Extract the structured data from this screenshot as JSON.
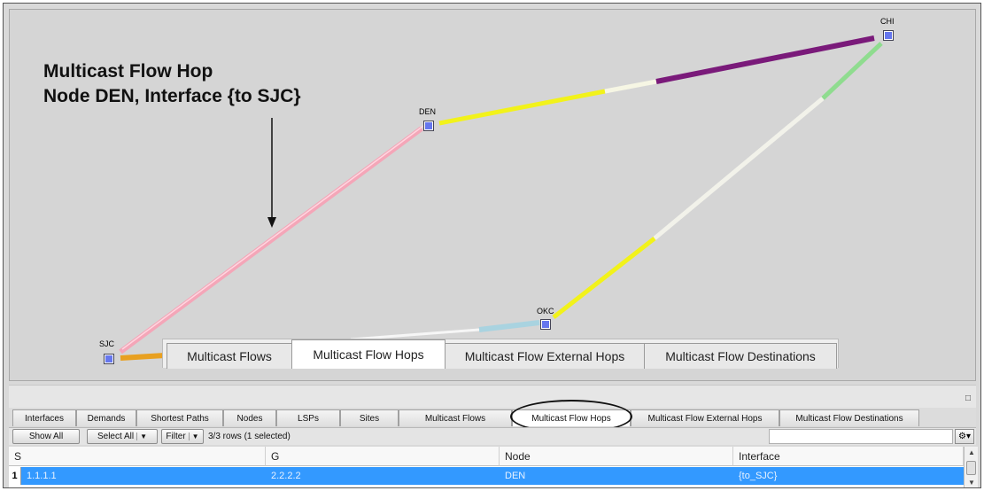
{
  "annotation": {
    "line1": "Multicast Flow Hop",
    "line2": "Node DEN, Interface {to SJC}"
  },
  "map": {
    "nodes": [
      {
        "id": "sjc",
        "label": "SJC"
      },
      {
        "id": "den",
        "label": "DEN"
      },
      {
        "id": "chi",
        "label": "CHI"
      },
      {
        "id": "okc",
        "label": "OKC"
      }
    ]
  },
  "overlay_tabs": [
    {
      "label": "Multicast Flows",
      "active": false
    },
    {
      "label": "Multicast Flow Hops",
      "active": true
    },
    {
      "label": "Multicast Flow External Hops",
      "active": false
    },
    {
      "label": "Multicast Flow Destinations",
      "active": false
    }
  ],
  "tabs": [
    {
      "label": "Interfaces"
    },
    {
      "label": "Demands"
    },
    {
      "label": "Shortest Paths"
    },
    {
      "label": "Nodes"
    },
    {
      "label": "LSPs"
    },
    {
      "label": "Sites"
    },
    {
      "label": "Multicast Flows"
    },
    {
      "label": "Multicast Flow Hops"
    },
    {
      "label": "Multicast Flow External Hops"
    },
    {
      "label": "Multicast Flow Destinations"
    }
  ],
  "toolbar": {
    "show_all": "Show All",
    "select_all": "Select All",
    "filter": "Filter",
    "rows_info": "3/3 rows (1 selected)"
  },
  "table": {
    "columns": [
      "S",
      "G",
      "Node",
      "Interface"
    ],
    "rows": [
      {
        "num": "1",
        "s": "1.1.1.1",
        "g": "2.2.2.2",
        "node": "DEN",
        "interface": "{to_SJC}",
        "selected": true
      }
    ]
  },
  "colors": {
    "node_fill": "#6677ee",
    "link_pink": "#f4a6b8",
    "link_yellow": "#f2f21a",
    "link_purple": "#7a1a7a",
    "link_green": "#8fdc8f",
    "link_orange": "#e8a020",
    "link_lightblue": "#a9d3e0",
    "selection": "#3399ff"
  },
  "icons": {
    "restore": "restore-window-icon",
    "dropdown": "chevron-down-icon",
    "settings": "gear-icon"
  }
}
